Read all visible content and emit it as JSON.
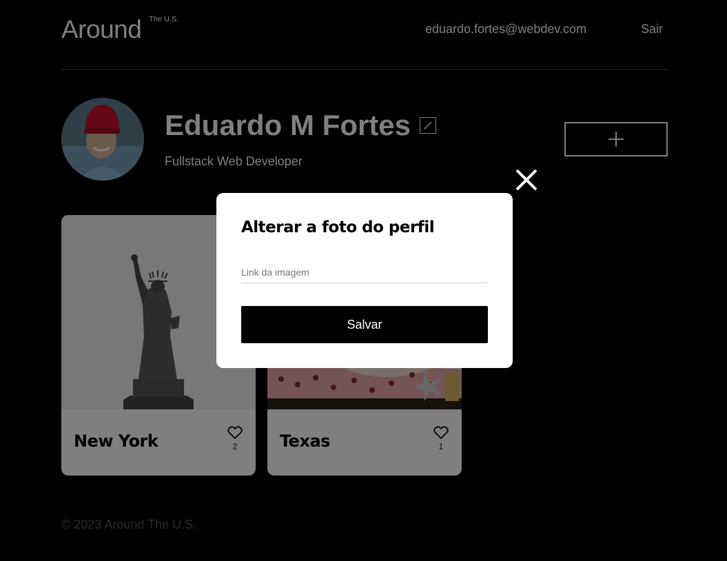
{
  "header": {
    "logo": "Around",
    "logo_sup": "The U.S.",
    "email": "eduardo.fortes@webdev.com",
    "logout": "Sair"
  },
  "profile": {
    "name": "Eduardo M Fortes",
    "about": "Fullstack Web Developer"
  },
  "cards": [
    {
      "title": "New York",
      "likes": "2"
    },
    {
      "title": "Texas",
      "likes": "1"
    }
  ],
  "footer": {
    "text": "© 2023 Around The U.S."
  },
  "modal": {
    "title": "Alterar a foto do perfil",
    "input_placeholder": "Link da imagem",
    "input_value": "",
    "save_label": "Salvar"
  },
  "icons": {
    "edit": "pencil-icon",
    "add": "plus-icon",
    "like": "heart-icon",
    "close": "close-icon"
  },
  "colors": {
    "background": "#000000",
    "modal_bg": "#ffffff",
    "button_bg": "#000000",
    "footer_text": "#545454",
    "avatar_hat": "#c8102e"
  }
}
